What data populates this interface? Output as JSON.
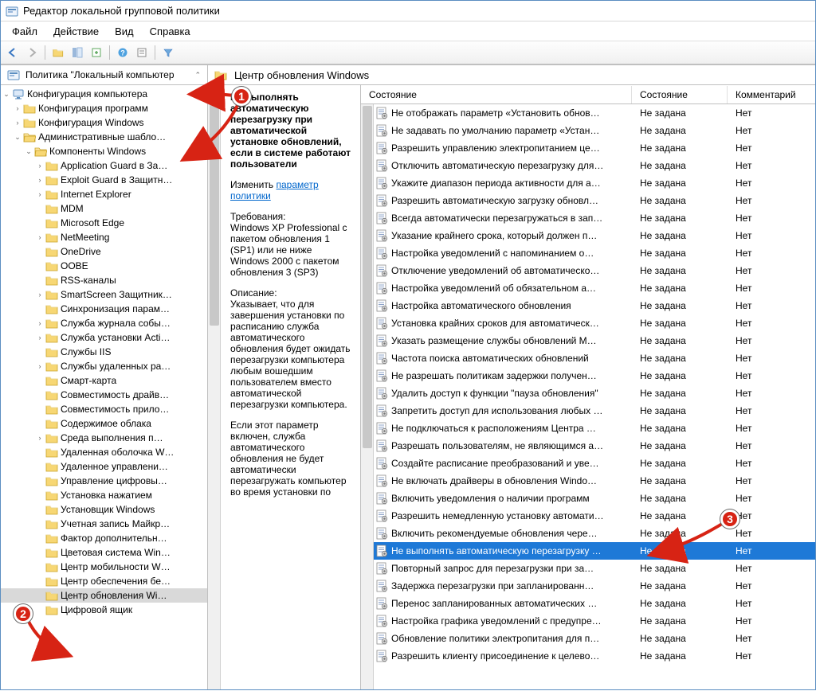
{
  "window": {
    "title": "Редактор локальной групповой политики"
  },
  "menu": {
    "file": "Файл",
    "action": "Действие",
    "view": "Вид",
    "help": "Справка"
  },
  "tree": {
    "root_label": "Политика \"Локальный компьютер",
    "computer_config": "Конфигурация компьютера",
    "software_config": "Конфигурация программ",
    "windows_config": "Конфигурация Windows",
    "admin_templates": "Административные шабло…",
    "win_components": "Компоненты Windows",
    "items": [
      "Application Guard в За…",
      "Exploit Guard в Защитн…",
      "Internet Explorer",
      "MDM",
      "Microsoft Edge",
      "NetMeeting",
      "OneDrive",
      "OOBE",
      "RSS-каналы",
      "SmartScreen Защитник…",
      "Синхронизация парам…",
      "Служба журнала собы…",
      "Служба установки Acti…",
      "Службы IIS",
      "Службы удаленных ра…",
      "Смарт-карта",
      "Совместимость драйв…",
      "Совместимость прило…",
      "Содержимое облака",
      "Среда выполнения п…",
      "Удаленная оболочка W…",
      "Удаленное управлени…",
      "Управление цифровы…",
      "Установка нажатием",
      "Установщик Windows",
      "Учетная запись Майкр…",
      "Фактор дополнительн…",
      "Цветовая система Win…",
      "Центр мобильности W…",
      "Центр обеспечения бе…",
      "Центр обновления Wi…",
      "Цифровой ящик"
    ],
    "selected_index": 30
  },
  "right": {
    "header": "Центр обновления Windows",
    "desc": {
      "policy_title": "Не выполнять автоматическую перезагрузку при автоматической установке обновлений, если в системе работают пользователи",
      "edit_label": "Изменить",
      "edit_link": "параметр политики",
      "req_label": "Требования:",
      "req_text": "Windows XP Professional с пакетом обновления 1 (SP1) или не ниже Windows 2000 с пакетом обновления 3 (SP3)",
      "desc_label": "Описание:",
      "desc_text1": "Указывает, что для завершения установки по расписанию служба автоматического обновления будет ожидать перезагрузки компьютера любым вошедшим пользователем вместо автоматической перезагрузки компьютера.",
      "desc_text2": "Если этот параметр включен, служба автоматического обновления не будет автоматически перезагружать компьютер во время установки по"
    },
    "columns": {
      "c1": "Состояние",
      "c2": "Состояние",
      "c3": "Комментарий"
    },
    "state_val": "Не задана",
    "comment_val": "Нет",
    "rows": [
      "Не отображать параметр «Установить обнов…",
      "Не задавать по умолчанию параметр «Устан…",
      "Разрешить управлению электропитанием це…",
      "Отключить автоматическую перезагрузку для…",
      "Укажите диапазон периода активности для а…",
      "Разрешить автоматическую загрузку обновл…",
      "Всегда автоматически перезагружаться в зап…",
      "Указание крайнего срока, который должен п…",
      "Настройка уведомлений с напоминанием о…",
      "Отключение уведомлений об автоматическо…",
      "Настройка уведомлений об обязательном а…",
      "Настройка автоматического обновления",
      "Установка крайних сроков для автоматическ…",
      "Указать размещение службы обновлений M…",
      "Частота поиска автоматических обновлений",
      "Не разрешать политикам задержки получен…",
      "Удалить доступ к функции \"пауза обновления\"",
      "Запретить доступ для использования любых …",
      "Не подключаться к расположениям Центра …",
      "Разрешать пользователям, не являющимся a…",
      "Создайте расписание преобразований и уве…",
      "Не включать драйверы в обновления Windo…",
      "Включить уведомления о наличии программ",
      "Разрешить немедленную установку автомати…",
      "Включить рекомендуемые обновления чере…",
      "Не выполнять автоматическую перезагрузку …",
      "Повторный запрос для перезагрузки при за…",
      "Задержка перезагрузки при запланированн…",
      "Перенос запланированных автоматических …",
      "Настройка графика уведомлений с предупре…",
      "Обновление политики электропитания для п…",
      "Разрешить клиенту присоединение к целево…"
    ],
    "selected_row": 25
  }
}
